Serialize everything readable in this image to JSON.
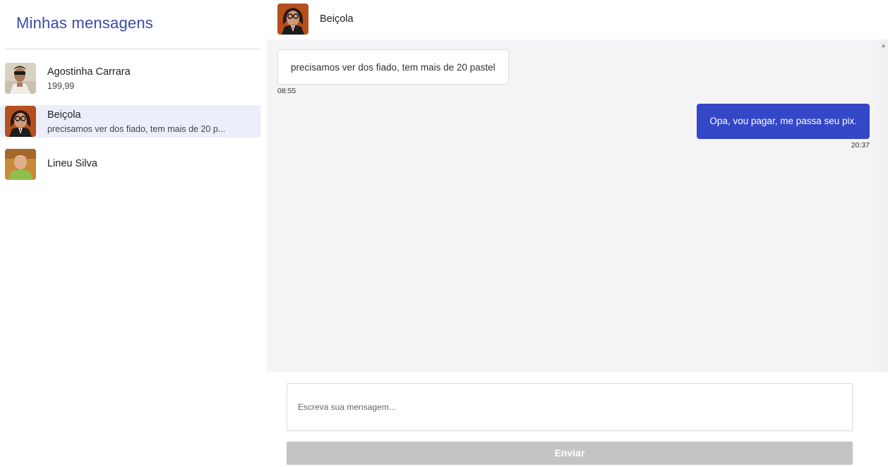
{
  "sidebar": {
    "title": "Minhas mensagens",
    "conversations": [
      {
        "name": "Agostinha Carrara",
        "preview": "199,99",
        "active": false
      },
      {
        "name": "Beiçola",
        "preview": "precisamos ver dos fiado, tem mais de 20 p...",
        "active": true
      },
      {
        "name": "Lineu Silva",
        "preview": "",
        "active": false
      }
    ]
  },
  "chat": {
    "contact_name": "Beiçola",
    "messages": [
      {
        "direction": "incoming",
        "text": "precisamos ver dos fiado, tem mais de 20 pastel",
        "time": "08:55"
      },
      {
        "direction": "outgoing",
        "text": "Opa, vou pagar, me passa seu pix.",
        "time": "20:37"
      }
    ],
    "input_placeholder": "Escreva sua mensagem...",
    "send_label": "Enviar"
  },
  "colors": {
    "accent": "#3347c7",
    "title": "#3b4aa6",
    "active_conversation": "#eceff9",
    "messages_background": "#f4f4f6",
    "send_button_disabled": "#c4c4c4"
  }
}
